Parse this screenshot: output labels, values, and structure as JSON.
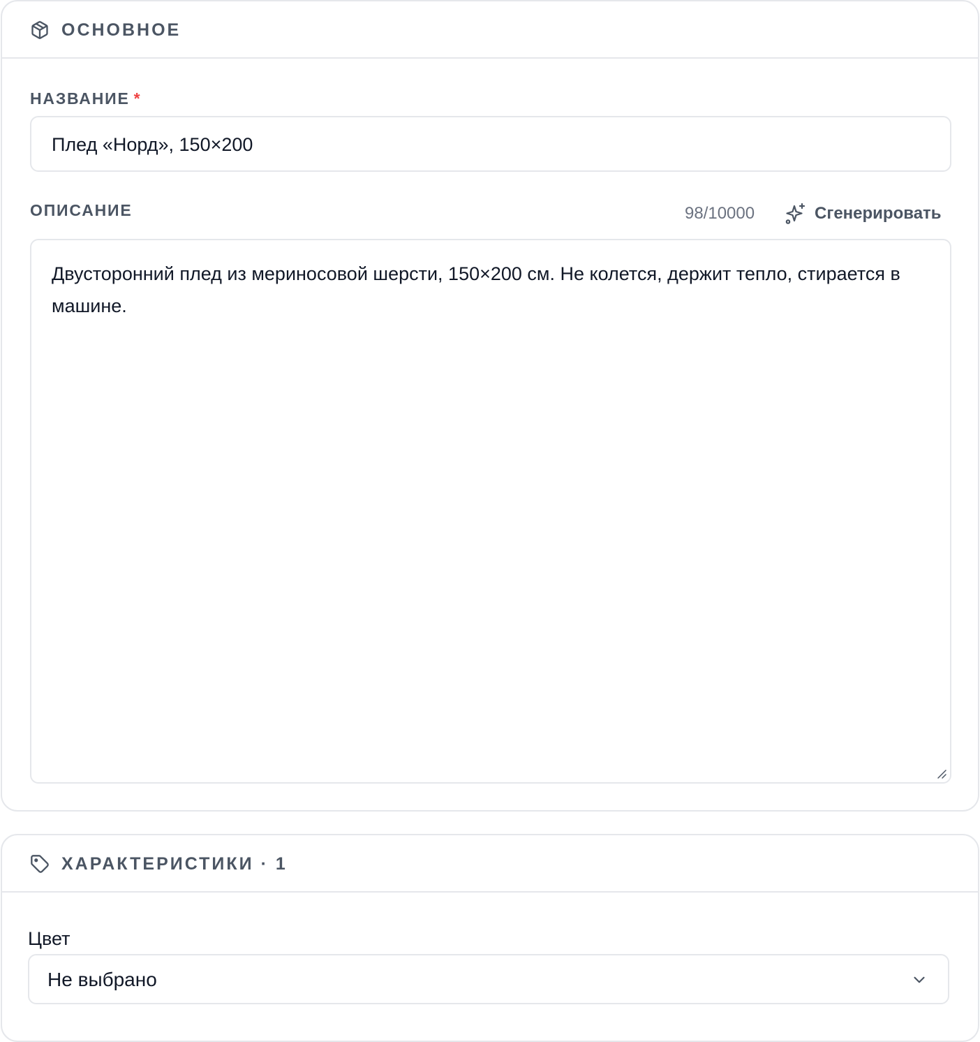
{
  "basic_section": {
    "title": "ОСНОВНОЕ",
    "icon": "package-icon"
  },
  "name_field": {
    "label": "НАЗВАНИЕ",
    "required_mark": "*",
    "value": "Плед «Норд», 150×200"
  },
  "description_field": {
    "label": "ОПИСАНИЕ",
    "counter": "98/10000",
    "generate_label": "Сгенерировать",
    "generate_icon": "sparkles-icon",
    "value": "Двусторонний плед из мериносовой шерсти, 150×200 см. Не колется, держит тепло, стирается в машине."
  },
  "specs_section": {
    "title": "ХАРАКТЕРИСТИКИ · 1",
    "icon": "tag-icon"
  },
  "color_field": {
    "label": "Цвет",
    "selected": "Не выбрано"
  },
  "colors": {
    "border": "#e5e7eb",
    "muted_text": "#4b5563",
    "required": "#ef4444",
    "text": "#111827"
  }
}
